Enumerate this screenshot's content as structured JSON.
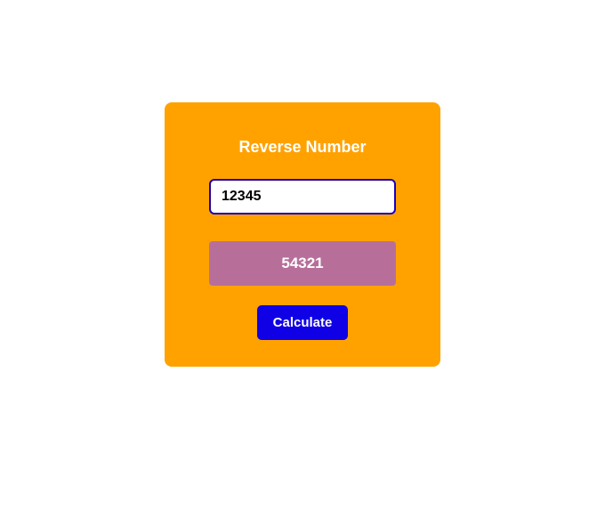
{
  "card": {
    "title": "Reverse Number",
    "input_value": "12345",
    "result": "54321",
    "button_label": "Calculate"
  }
}
